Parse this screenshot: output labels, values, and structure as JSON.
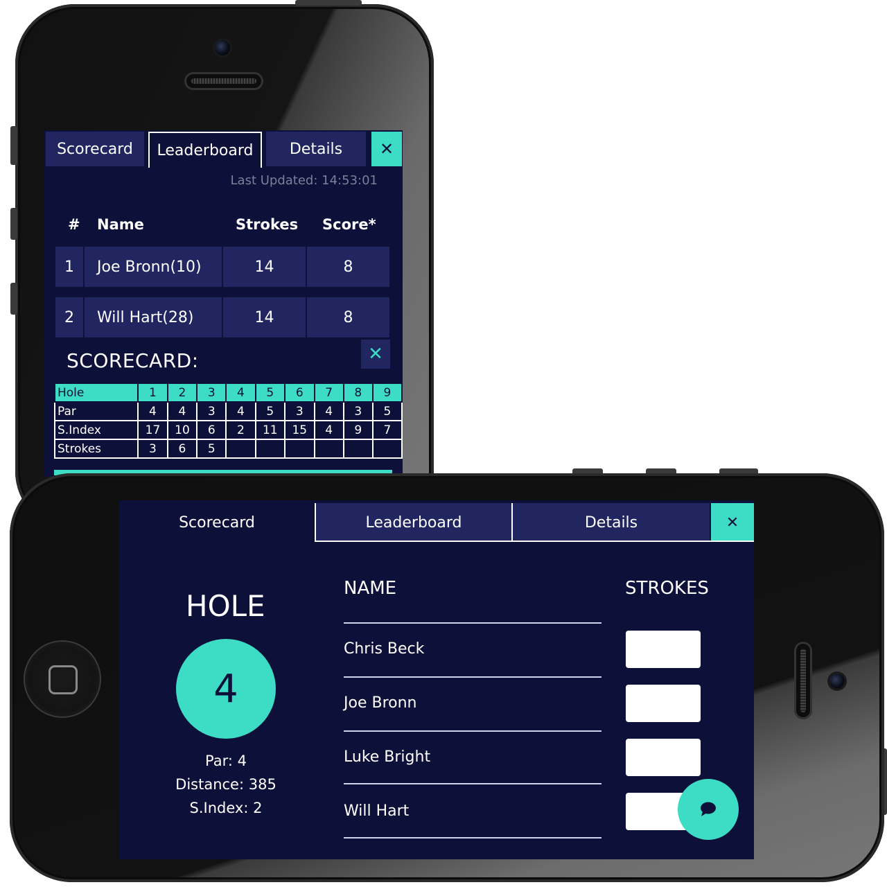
{
  "portrait": {
    "tabs": [
      "Scorecard",
      "Leaderboard",
      "Details"
    ],
    "active_tab": "Leaderboard",
    "close_symbol": "✕",
    "last_updated": "Last Updated: 14:53:01",
    "leaderboard": {
      "headers": [
        "#",
        "Name",
        "Strokes",
        "Score*"
      ],
      "rows": [
        {
          "rank": "1",
          "name": "Joe Bronn(10)",
          "strokes": "14",
          "score": "8"
        },
        {
          "rank": "2",
          "name": "Will Hart(28)",
          "strokes": "14",
          "score": "8"
        }
      ]
    },
    "scorecard": {
      "title": "SCORECARD:",
      "rows": [
        {
          "label": "Hole",
          "values": [
            "1",
            "2",
            "3",
            "4",
            "5",
            "6",
            "7",
            "8",
            "9"
          ]
        },
        {
          "label": "Par",
          "values": [
            "4",
            "4",
            "3",
            "4",
            "5",
            "3",
            "4",
            "3",
            "5"
          ]
        },
        {
          "label": "S.Index",
          "values": [
            "17",
            "10",
            "6",
            "2",
            "11",
            "15",
            "4",
            "9",
            "7"
          ]
        },
        {
          "label": "Strokes",
          "values": [
            "3",
            "6",
            "5",
            "",
            "",
            "",
            "",
            "",
            ""
          ]
        }
      ]
    }
  },
  "landscape": {
    "tabs": [
      "Scorecard",
      "Leaderboard",
      "Details"
    ],
    "active_tab": "Scorecard",
    "close_symbol": "✕",
    "hole": {
      "title": "HOLE",
      "number": "4",
      "par": "Par: 4",
      "distance": "Distance: 385",
      "sindex": "S.Index: 2"
    },
    "columns": {
      "name": "NAME",
      "strokes": "STROKES"
    },
    "players": [
      "Chris Beck",
      "Joe Bronn",
      "Luke Bright",
      "Will Hart"
    ]
  },
  "icons": {
    "close": "close-icon",
    "chat": "chat-bubble-icon",
    "camera": "camera-icon",
    "speaker": "speaker-icon",
    "home": "home-button-icon"
  },
  "colors": {
    "background": "#0d1038",
    "tab": "#212660",
    "accent": "#3ddcc5",
    "text": "#ffffff"
  }
}
